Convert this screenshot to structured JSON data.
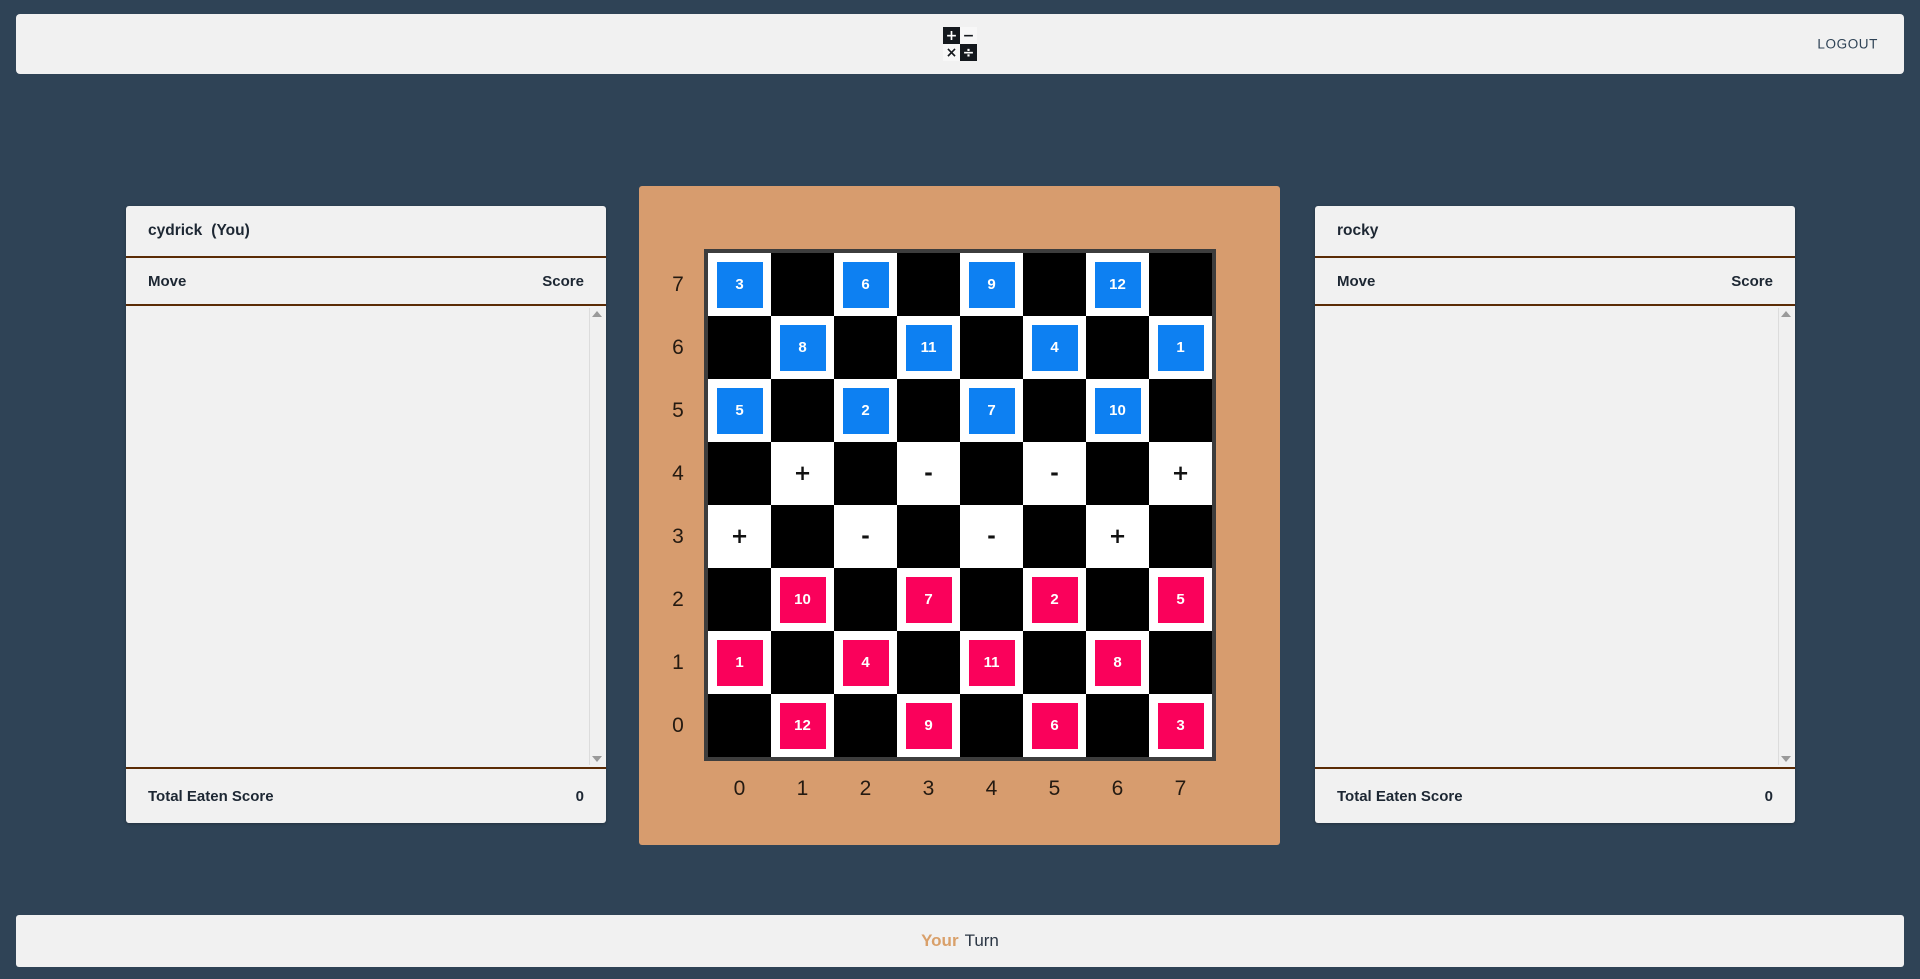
{
  "navbar": {
    "logo_cells": [
      {
        "glyph": "+",
        "style": "dark"
      },
      {
        "glyph": "−",
        "style": "light"
      },
      {
        "glyph": "×",
        "style": "light"
      },
      {
        "glyph": "÷",
        "style": "dark"
      }
    ],
    "logout_label": "LOGOUT"
  },
  "players": {
    "left": {
      "name": "cydrick",
      "you_tag": "(You)",
      "col_move": "Move",
      "col_score": "Score",
      "moves": [],
      "footer_label": "Total Eaten Score",
      "footer_value": "0"
    },
    "right": {
      "name": "rocky",
      "you_tag": "",
      "col_move": "Move",
      "col_score": "Score",
      "moves": [],
      "footer_label": "Total Eaten Score",
      "footer_value": "0"
    }
  },
  "board": {
    "row_labels": [
      "7",
      "6",
      "5",
      "4",
      "3",
      "2",
      "1",
      "0"
    ],
    "col_labels": [
      "0",
      "1",
      "2",
      "3",
      "4",
      "5",
      "6",
      "7"
    ],
    "colors": {
      "frame": "#d79c6e",
      "dark_square": "#000000",
      "light_square": "#ffffff",
      "blue_piece": "#0d80f2",
      "pink_piece": "#fa015b"
    },
    "rows": [
      {
        "label": "7",
        "cells": [
          {
            "shade": "light",
            "piece": "3",
            "team": "blue"
          },
          {
            "shade": "dark",
            "piece": null,
            "team": null
          },
          {
            "shade": "light",
            "piece": "6",
            "team": "blue"
          },
          {
            "shade": "dark",
            "piece": null,
            "team": null
          },
          {
            "shade": "light",
            "piece": "9",
            "team": "blue"
          },
          {
            "shade": "dark",
            "piece": null,
            "team": null
          },
          {
            "shade": "light",
            "piece": "12",
            "team": "blue"
          },
          {
            "shade": "dark",
            "piece": null,
            "team": null
          }
        ]
      },
      {
        "label": "6",
        "cells": [
          {
            "shade": "dark",
            "piece": null,
            "team": null
          },
          {
            "shade": "light",
            "piece": "8",
            "team": "blue"
          },
          {
            "shade": "dark",
            "piece": null,
            "team": null
          },
          {
            "shade": "light",
            "piece": "11",
            "team": "blue"
          },
          {
            "shade": "dark",
            "piece": null,
            "team": null
          },
          {
            "shade": "light",
            "piece": "4",
            "team": "blue"
          },
          {
            "shade": "dark",
            "piece": null,
            "team": null
          },
          {
            "shade": "light",
            "piece": "1",
            "team": "blue"
          }
        ]
      },
      {
        "label": "5",
        "cells": [
          {
            "shade": "light",
            "piece": "5",
            "team": "blue"
          },
          {
            "shade": "dark",
            "piece": null,
            "team": null
          },
          {
            "shade": "light",
            "piece": "2",
            "team": "blue"
          },
          {
            "shade": "dark",
            "piece": null,
            "team": null
          },
          {
            "shade": "light",
            "piece": "7",
            "team": "blue"
          },
          {
            "shade": "dark",
            "piece": null,
            "team": null
          },
          {
            "shade": "light",
            "piece": "10",
            "team": "blue"
          },
          {
            "shade": "dark",
            "piece": null,
            "team": null
          }
        ]
      },
      {
        "label": "4",
        "cells": [
          {
            "shade": "dark",
            "piece": null,
            "team": null,
            "operator": null
          },
          {
            "shade": "light",
            "piece": null,
            "team": null,
            "operator": "+"
          },
          {
            "shade": "dark",
            "piece": null,
            "team": null,
            "operator": null
          },
          {
            "shade": "light",
            "piece": null,
            "team": null,
            "operator": "-"
          },
          {
            "shade": "dark",
            "piece": null,
            "team": null,
            "operator": null
          },
          {
            "shade": "light",
            "piece": null,
            "team": null,
            "operator": "-"
          },
          {
            "shade": "dark",
            "piece": null,
            "team": null,
            "operator": null
          },
          {
            "shade": "light",
            "piece": null,
            "team": null,
            "operator": "+"
          }
        ]
      },
      {
        "label": "3",
        "cells": [
          {
            "shade": "light",
            "piece": null,
            "team": null,
            "operator": "+"
          },
          {
            "shade": "dark",
            "piece": null,
            "team": null,
            "operator": null
          },
          {
            "shade": "light",
            "piece": null,
            "team": null,
            "operator": "-"
          },
          {
            "shade": "dark",
            "piece": null,
            "team": null,
            "operator": null
          },
          {
            "shade": "light",
            "piece": null,
            "team": null,
            "operator": "-"
          },
          {
            "shade": "dark",
            "piece": null,
            "team": null,
            "operator": null
          },
          {
            "shade": "light",
            "piece": null,
            "team": null,
            "operator": "+"
          },
          {
            "shade": "dark",
            "piece": null,
            "team": null,
            "operator": null
          }
        ]
      },
      {
        "label": "2",
        "cells": [
          {
            "shade": "dark",
            "piece": null,
            "team": null
          },
          {
            "shade": "light",
            "piece": "10",
            "team": "pink"
          },
          {
            "shade": "dark",
            "piece": null,
            "team": null
          },
          {
            "shade": "light",
            "piece": "7",
            "team": "pink"
          },
          {
            "shade": "dark",
            "piece": null,
            "team": null
          },
          {
            "shade": "light",
            "piece": "2",
            "team": "pink"
          },
          {
            "shade": "dark",
            "piece": null,
            "team": null
          },
          {
            "shade": "light",
            "piece": "5",
            "team": "pink"
          }
        ]
      },
      {
        "label": "1",
        "cells": [
          {
            "shade": "light",
            "piece": "1",
            "team": "pink"
          },
          {
            "shade": "dark",
            "piece": null,
            "team": null
          },
          {
            "shade": "light",
            "piece": "4",
            "team": "pink"
          },
          {
            "shade": "dark",
            "piece": null,
            "team": null
          },
          {
            "shade": "light",
            "piece": "11",
            "team": "pink"
          },
          {
            "shade": "dark",
            "piece": null,
            "team": null
          },
          {
            "shade": "light",
            "piece": "8",
            "team": "pink"
          },
          {
            "shade": "dark",
            "piece": null,
            "team": null
          }
        ]
      },
      {
        "label": "0",
        "cells": [
          {
            "shade": "dark",
            "piece": null,
            "team": null
          },
          {
            "shade": "light",
            "piece": "12",
            "team": "pink"
          },
          {
            "shade": "dark",
            "piece": null,
            "team": null
          },
          {
            "shade": "light",
            "piece": "9",
            "team": "pink"
          },
          {
            "shade": "dark",
            "piece": null,
            "team": null
          },
          {
            "shade": "light",
            "piece": "6",
            "team": "pink"
          },
          {
            "shade": "dark",
            "piece": null,
            "team": null
          },
          {
            "shade": "light",
            "piece": "3",
            "team": "pink"
          }
        ]
      }
    ]
  },
  "turn_bar": {
    "accent_word": "Your",
    "rest_word": "Turn"
  }
}
